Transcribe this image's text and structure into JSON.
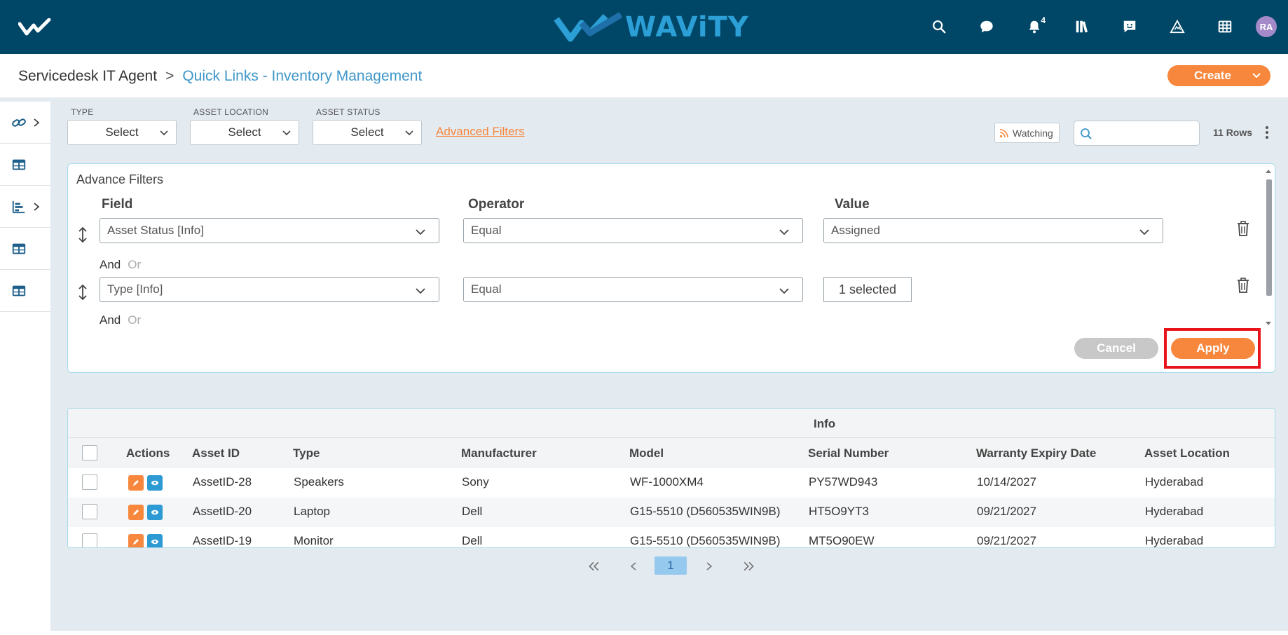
{
  "brand": {
    "name": "WAViTY"
  },
  "header": {
    "notification_count": "4",
    "avatar_initials": "RA"
  },
  "breadcrumb": {
    "root": "Servicedesk IT Agent",
    "separator": ">",
    "current": "Quick Links - Inventory Management"
  },
  "create_label": "Create",
  "filters": {
    "type": {
      "label": "TYPE",
      "value": "Select"
    },
    "location": {
      "label": "ASSET LOCATION",
      "value": "Select"
    },
    "status": {
      "label": "ASSET STATUS",
      "value": "Select"
    },
    "advanced_link": "Advanced Filters",
    "watching_label": "Watching",
    "search_placeholder": "",
    "rows_count": "11 Rows"
  },
  "advance_filters": {
    "title": "Advance Filters",
    "columns": {
      "field": "Field",
      "operator": "Operator",
      "value": "Value"
    },
    "rows": [
      {
        "field": "Asset Status [Info]",
        "operator": "Equal",
        "value": "Assigned"
      },
      {
        "field": "Type [Info]",
        "operator": "Equal",
        "value": "1 selected"
      }
    ],
    "and_label": "And",
    "or_label": "Or",
    "cancel_label": "Cancel",
    "apply_label": "Apply"
  },
  "table": {
    "group_header": "Info",
    "columns": [
      "Actions",
      "Asset ID",
      "Type",
      "Manufacturer",
      "Model",
      "Serial Number",
      "Warranty Expiry Date",
      "Asset Location"
    ],
    "rows": [
      {
        "asset_id": "AssetID-28",
        "type": "Speakers",
        "manufacturer": "Sony",
        "model": "WF-1000XM4",
        "serial": "PY57WD943",
        "warranty": "10/14/2027",
        "location": "Hyderabad"
      },
      {
        "asset_id": "AssetID-20",
        "type": "Laptop",
        "manufacturer": "Dell",
        "model": "G15-5510 (D560535WIN9B)",
        "serial": "HT5O9YT3",
        "warranty": "09/21/2027",
        "location": "Hyderabad"
      },
      {
        "asset_id": "AssetID-19",
        "type": "Monitor",
        "manufacturer": "Dell",
        "model": "G15-5510 (D560535WIN9B)",
        "serial": "MT5O90EW",
        "warranty": "09/21/2027",
        "location": "Hyderabad"
      }
    ]
  },
  "pagination": {
    "current_page": "1"
  },
  "colors": {
    "header_bg": "#004666",
    "accent": "#f7873d",
    "link": "#3f97c9",
    "highlight": "#e8141b"
  }
}
